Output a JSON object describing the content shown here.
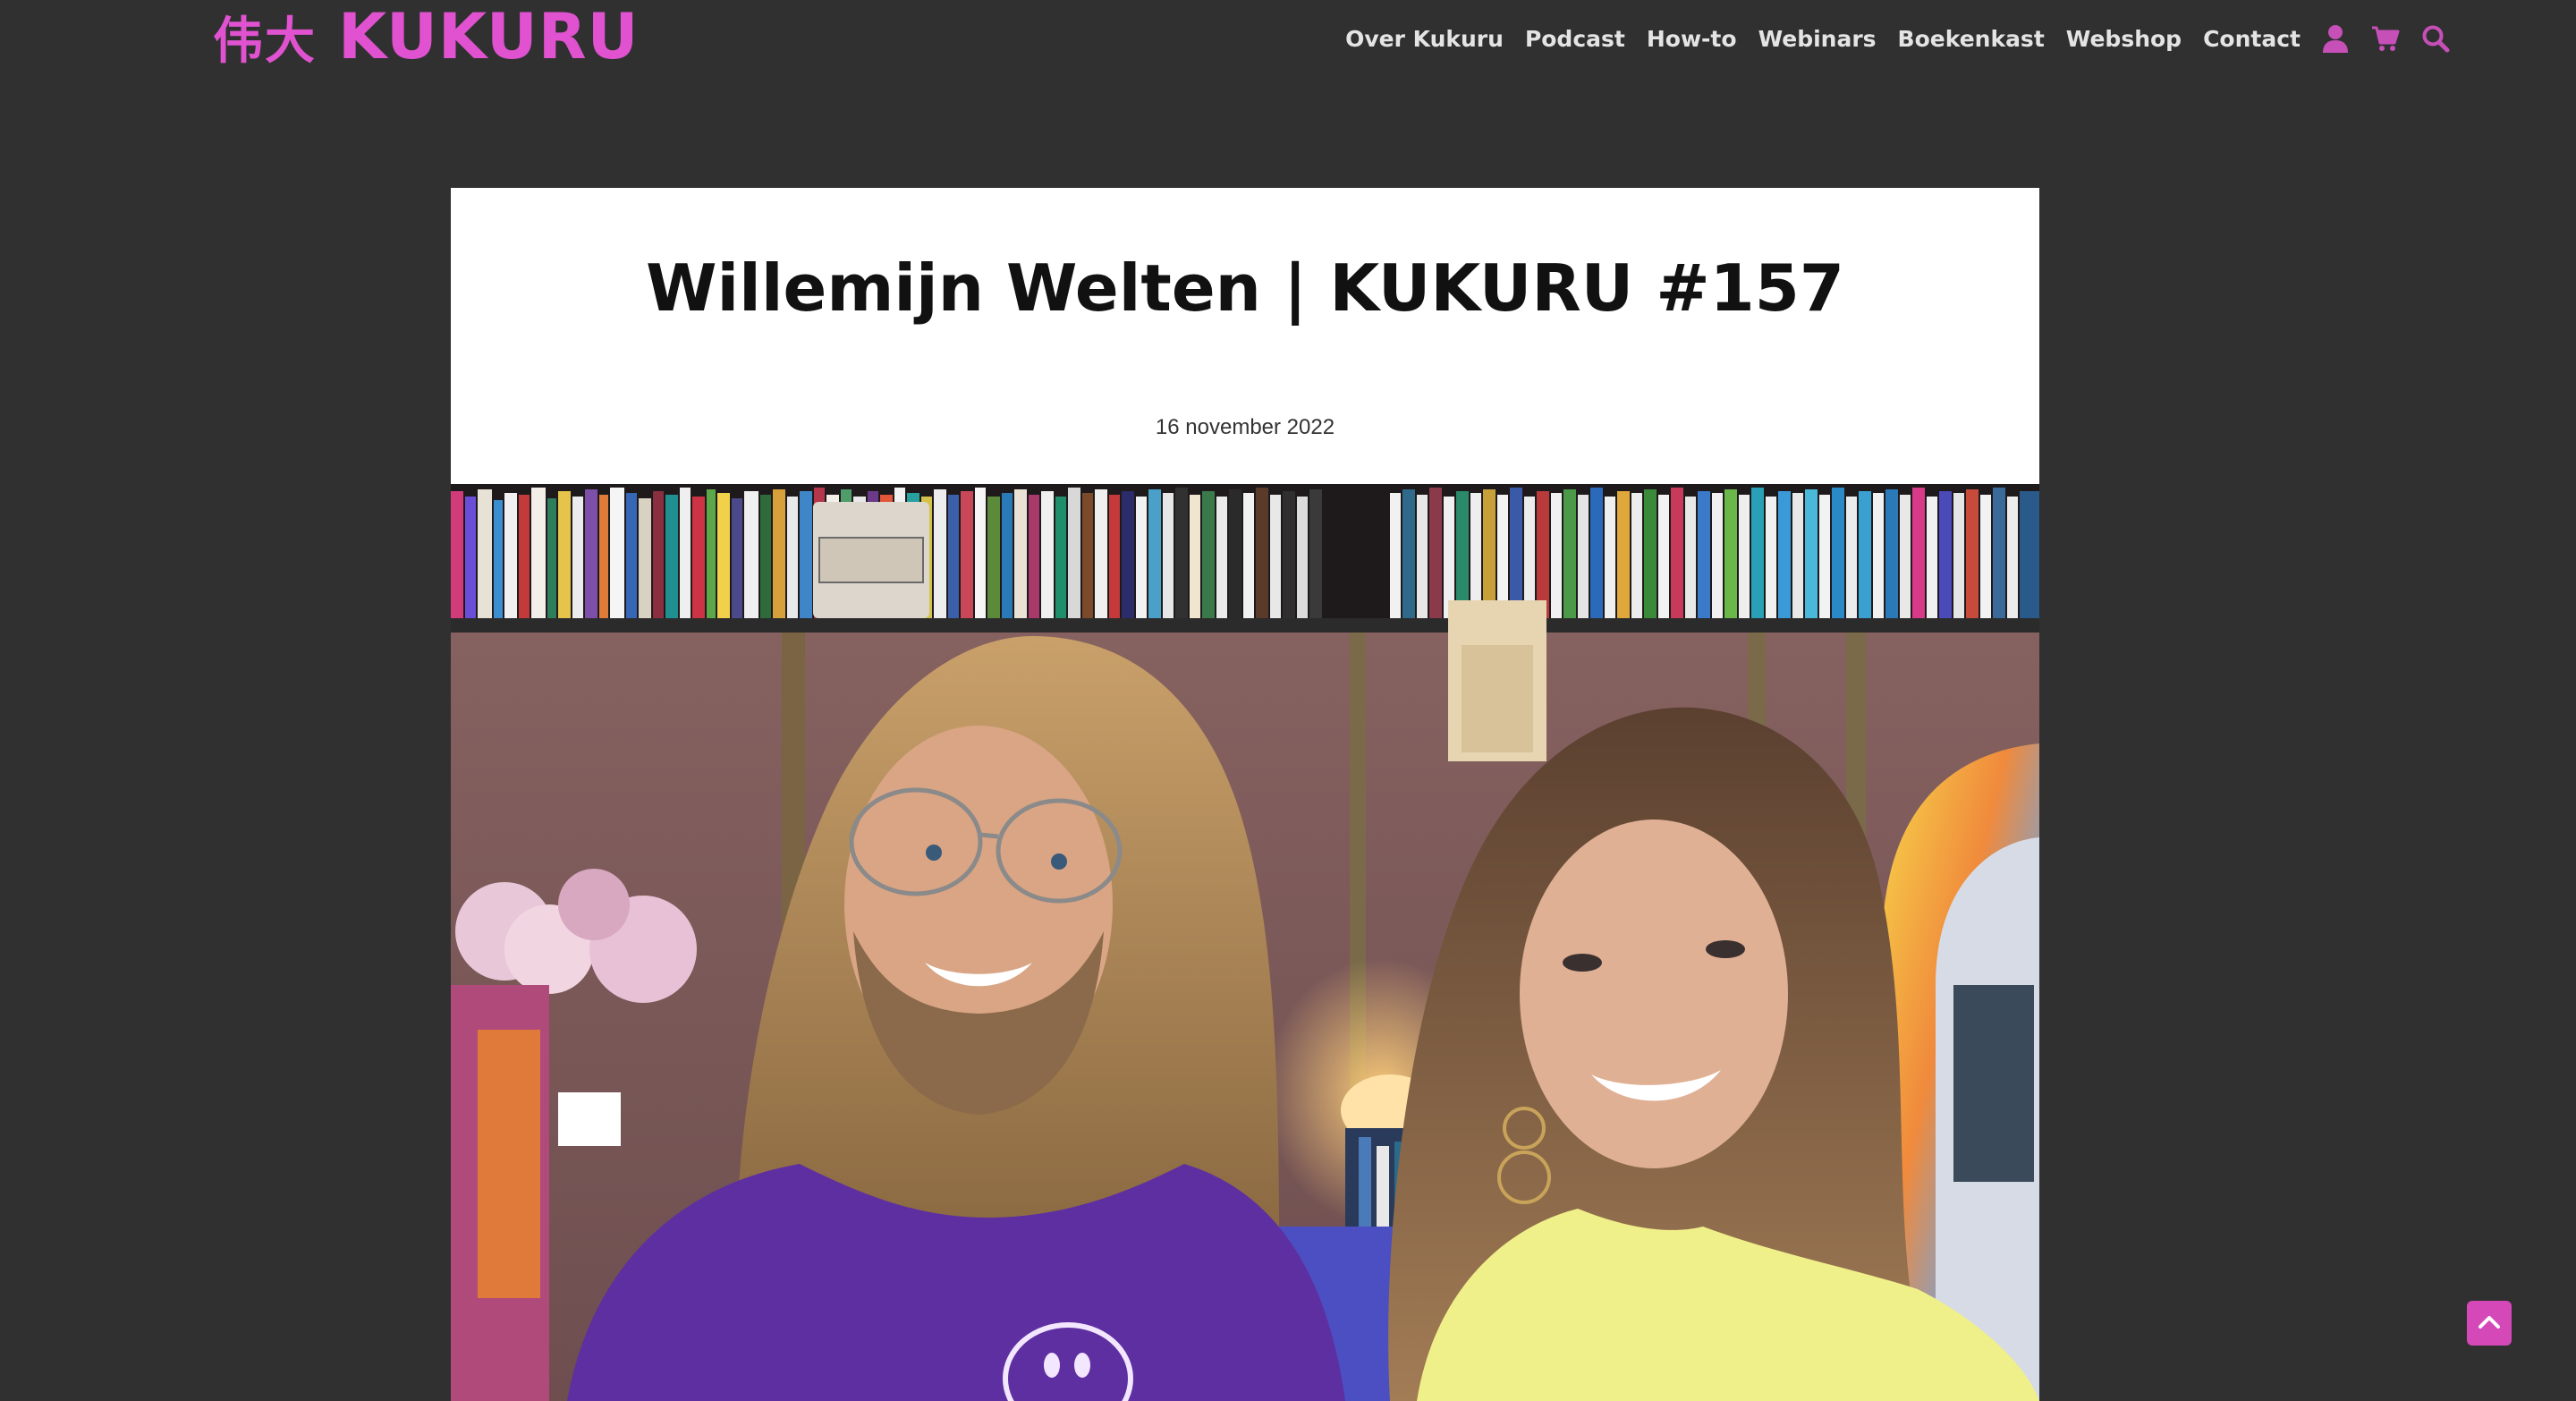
{
  "brand": {
    "logo_cjk": "伟大",
    "logo_text": "KUKURU",
    "accent_color": "#e052d0"
  },
  "nav": {
    "items": [
      {
        "label": "Over Kukuru"
      },
      {
        "label": "Podcast"
      },
      {
        "label": "How-to"
      },
      {
        "label": "Webinars"
      },
      {
        "label": "Boekenkast"
      },
      {
        "label": "Webshop"
      },
      {
        "label": "Contact"
      }
    ],
    "icons": [
      "user-icon",
      "cart-icon",
      "search-icon"
    ]
  },
  "article": {
    "title": "Willemijn Welten | KUKURU #157",
    "date": "16 november 2022",
    "hero_image": "photo-two-people-smiling-bookshelf"
  },
  "back_to_top": {
    "icon": "chevron-up-icon",
    "color": "#d548b8"
  }
}
